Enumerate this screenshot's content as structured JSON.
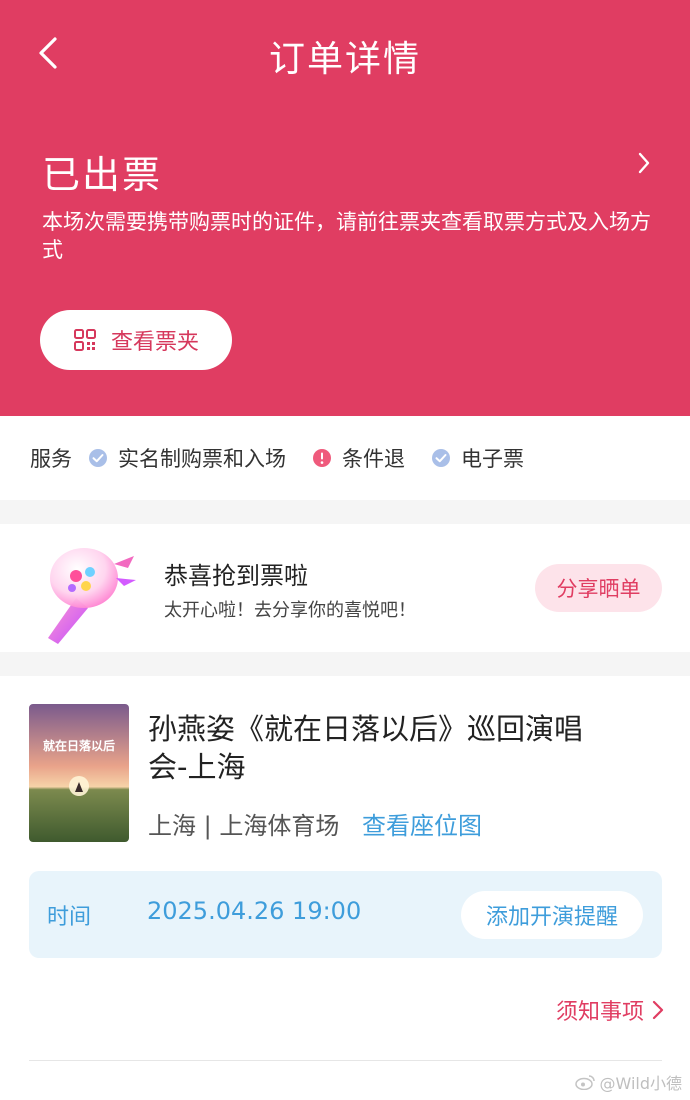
{
  "header": {
    "title": "订单详情",
    "status": "已出票",
    "description": "本场次需要携带购票时的证件，请前往票夹查看取票方式及入场方式",
    "ticket_button": "查看票夹",
    "bg_color": "#e03d62"
  },
  "services": {
    "label": "服务",
    "items": [
      {
        "label": "实名制购票和入场",
        "icon": "check-circle-icon"
      },
      {
        "label": "条件退",
        "icon": "alert-circle-icon"
      },
      {
        "label": "电子票",
        "icon": "check-circle-icon"
      }
    ]
  },
  "share": {
    "title": "恭喜抢到票啦",
    "subtitle": "太开心啦！去分享你的喜悦吧！",
    "button": "分享晒单"
  },
  "event": {
    "title": "孙燕姿《就在日落以后》巡回演唱会-上海",
    "venue": "上海 | 上海体育场",
    "seat_link": "查看座位图",
    "poster_text": "就在日落以后",
    "time_label": "时间",
    "time_value": "2025.04.26 19:00",
    "reminder_button": "添加开演提醒",
    "notice_link": "须知事项"
  },
  "watermark": "@Wild小德",
  "colors": {
    "accent": "#e03d62",
    "link_blue": "#3e9ddb",
    "time_box_bg": "#e8f4fb"
  }
}
